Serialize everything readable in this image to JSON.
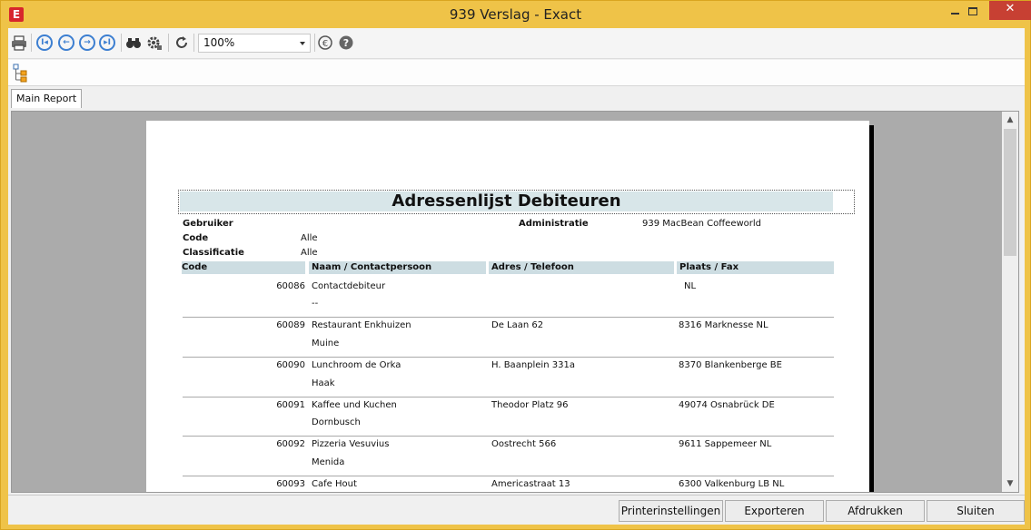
{
  "window": {
    "title": "939 Verslag - Exact",
    "app_icon_letter": "E"
  },
  "toolbar": {
    "zoom_value": "100%"
  },
  "tabs": [
    {
      "label": "Main Report"
    }
  ],
  "report": {
    "title": "Adressenlijst Debiteuren",
    "filters": [
      {
        "label": "Gebruiker",
        "value": ""
      },
      {
        "label": "Code",
        "value": "Alle"
      },
      {
        "label": "Classificatie",
        "value": "Alle"
      }
    ],
    "admin": {
      "label": "Administratie",
      "value": "939 MacBean Coffeeworld"
    },
    "columns": [
      "Code",
      "Naam / Contactpersoon",
      "Adres / Telefoon",
      "Plaats / Fax"
    ],
    "rows": [
      {
        "code": "60086",
        "name": "Contactdebiteur",
        "contact": "--",
        "address": "",
        "city": "NL"
      },
      {
        "code": "60089",
        "name": "Restaurant Enkhuizen",
        "contact": "Muine",
        "address": "De Laan 62",
        "city": "8316 Marknesse NL"
      },
      {
        "code": "60090",
        "name": "Lunchroom de Orka",
        "contact": "Haak",
        "address": "H. Baanplein 331a",
        "city": "8370 Blankenberge BE"
      },
      {
        "code": "60091",
        "name": "Kaffee und Kuchen",
        "contact": "Dornbusch",
        "address": "Theodor Platz 96",
        "city": "49074 Osnabrück DE"
      },
      {
        "code": "60092",
        "name": "Pizzeria Vesuvius",
        "contact": "Menida",
        "address": "Oostrecht 566",
        "city": "9611 Sappemeer NL"
      },
      {
        "code": "60093",
        "name": "Cafe Hout",
        "contact": "",
        "address": "Americastraat 13",
        "city": "6300 Valkenburg LB NL"
      }
    ]
  },
  "buttons": {
    "printer": "Printerinstellingen",
    "export": "Exporteren",
    "print": "Afdrukken",
    "close": "Sluiten"
  }
}
